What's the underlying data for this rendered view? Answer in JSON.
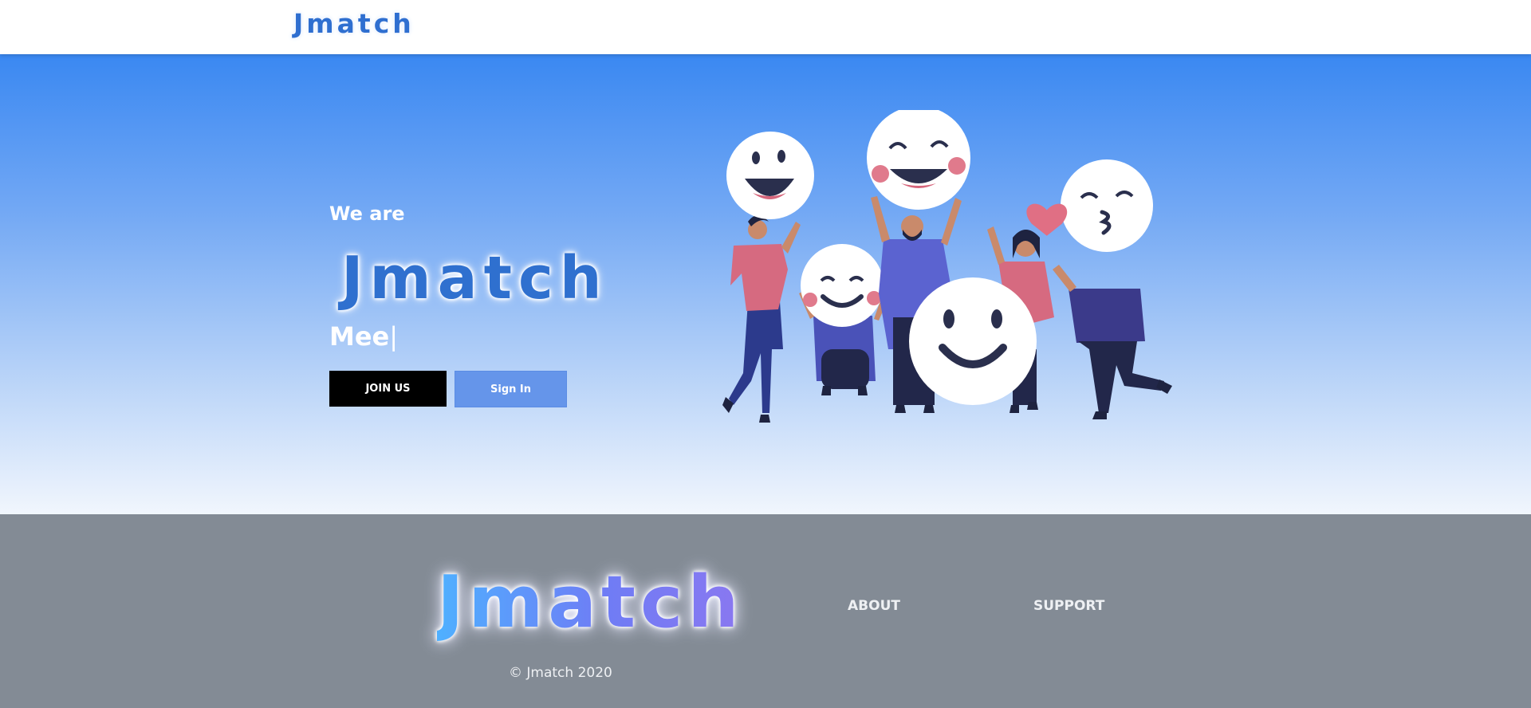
{
  "header": {
    "logo_text": "Jmatch"
  },
  "hero": {
    "intro": "We are",
    "logo_text": "Jmatch",
    "typing_text": "Mee",
    "cursor": "|",
    "join_label": "JOIN US",
    "signin_label": "Sign In"
  },
  "footer": {
    "logo_text": "Jmatch",
    "copyright": "© Jmatch 2020",
    "nav": {
      "about": "ABOUT",
      "support": "SUPPORT"
    }
  },
  "colors": {
    "brand_blue": "#2f70cf",
    "hero_top": "#3a88f2",
    "signin_button": "#6595ea",
    "footer_bg": "#838b95"
  }
}
